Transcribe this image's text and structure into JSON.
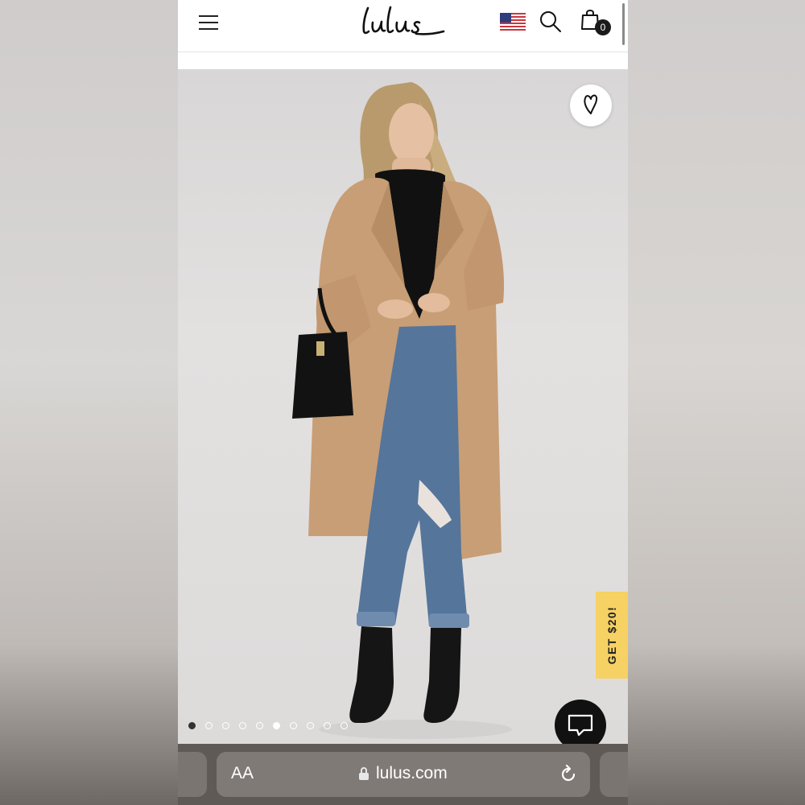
{
  "site": {
    "brand": "Lulus",
    "cart_count": "0"
  },
  "header": {
    "icons": [
      "menu-icon",
      "us-flag-icon",
      "search-icon",
      "shopping-bag-icon"
    ]
  },
  "product_gallery": {
    "image_alt": "Model wearing tan long wool coat, black turtleneck, distressed jeans and black ankle boots holding a black croc-embossed bucket bag",
    "promo_label": "GET $20!",
    "image_count": 10,
    "active_index": 0,
    "icons": [
      "heart-icon",
      "chat-icon"
    ]
  },
  "browser": {
    "text_size_label": "AA",
    "url": "lulus.com",
    "icons": [
      "lock-icon",
      "reload-icon"
    ]
  },
  "colors": {
    "promo": "#f6d163",
    "chat": "#111111",
    "browser_bar": "#5f5a56"
  }
}
